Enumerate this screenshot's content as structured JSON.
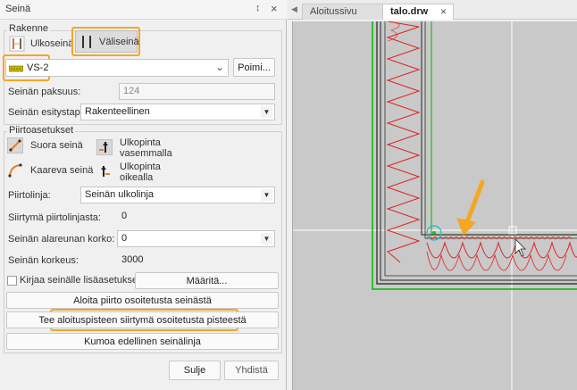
{
  "panel": {
    "title": "Seinä",
    "pin": "↕",
    "close": "×"
  },
  "rakenne": {
    "legend": "Rakenne",
    "ulkoseina": "Ulkoseinä",
    "valiseina": "Väliseinä",
    "type_value": "VS-2",
    "poimi": "Poimi...",
    "paksuus_label": "Seinän paksuus:",
    "paksuus_value": "124",
    "esitystapa_label": "Seinän esitystapa:",
    "esitystapa_value": "Rakenteellinen"
  },
  "piirto": {
    "legend": "Piirtoasetukset",
    "suora": "Suora seinä",
    "kaareva": "Kaareva seinä",
    "ulko_vas_1": "Ulkopinta",
    "ulko_vas_2": "vasemmalla",
    "ulko_oik_1": "Ulkopinta",
    "ulko_oik_2": "oikealla",
    "piirtolinja_label": "Piirtolinja:",
    "piirtolinja_value": "Seinän ulkolinja",
    "siirtyma_label": "Siirtymä piirtolinjasta:",
    "siirtyma_value": "0",
    "alareuna_label": "Seinän alareunan korko:",
    "alareuna_value": "0",
    "korkeus_label": "Seinän korkeus:",
    "korkeus_value": "3000",
    "kirjaa_label": "Kirjaa seinälle lisäasetukset:",
    "maarita": "Määritä...",
    "btn_aloita": "Aloita piirto osoitetusta seinästä",
    "btn_tee": "Tee aloituspisteen siirtymä osoitetusta pisteestä",
    "btn_kumoa": "Kumoa edellinen seinälinja"
  },
  "footer": {
    "sulje": "Sulje",
    "yhdista": "Yhdistä"
  },
  "tabs": {
    "tab1": "Aloitussivu",
    "tab2": "talo.drw",
    "tab2_close": "×"
  },
  "colors": {
    "highlight": "#f5a623",
    "wall_red": "#e02020",
    "wall_green": "#22bb22"
  }
}
